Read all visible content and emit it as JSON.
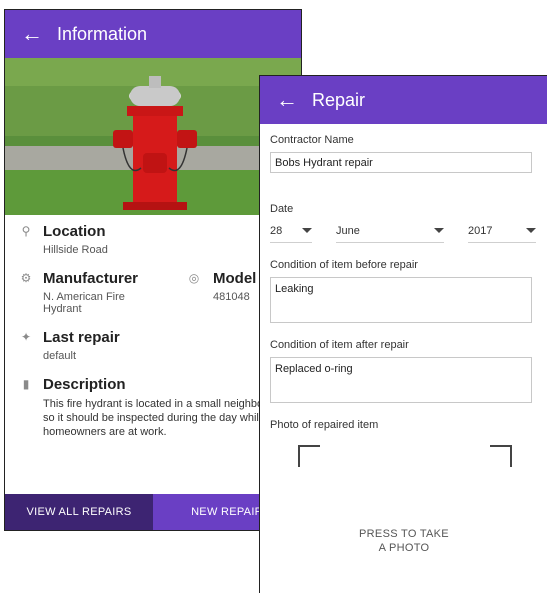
{
  "info": {
    "title": "Information",
    "location": {
      "heading": "Location",
      "value": "Hillside Road"
    },
    "manufacturer": {
      "heading": "Manufacturer",
      "value": "N. American Fire Hydrant"
    },
    "model": {
      "heading": "Model Num",
      "value": "481048"
    },
    "last_repair": {
      "heading": "Last repair",
      "value": "default"
    },
    "description": {
      "heading": "Description",
      "value": "This fire hydrant is located in a small neighborhood, so it should be inspected during the day while homeowners are at work."
    },
    "tabs": {
      "view_all": "VIEW ALL REPAIRS",
      "new_repair": "NEW REPAIR"
    }
  },
  "repair": {
    "title": "Repair",
    "contractor_label": "Contractor Name",
    "contractor_value": "Bobs Hydrant repair",
    "date_label": "Date",
    "date": {
      "day": "28",
      "month": "June",
      "year": "2017"
    },
    "before_label": "Condition of item before repair",
    "before_value": "Leaking",
    "after_label": "Condition of item after repair",
    "after_value": "Replaced o-ring",
    "photo_label": "Photo of repaired item",
    "photo_prompt_1": "PRESS TO TAKE",
    "photo_prompt_2": "A PHOTO"
  },
  "colors": {
    "primary": "#6a3fc4",
    "primary_dark": "#3d2472"
  }
}
